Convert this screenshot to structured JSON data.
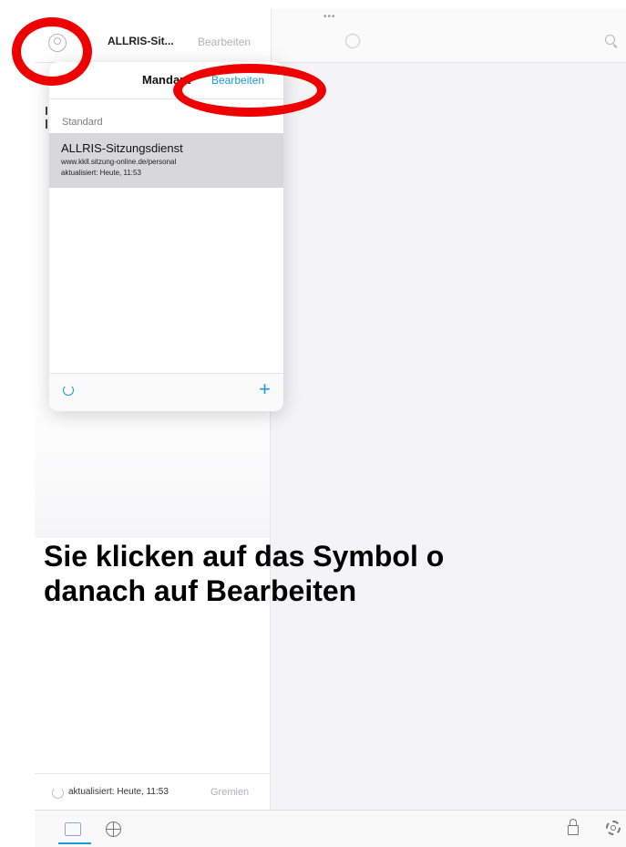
{
  "header": {
    "title": "ALLRIS-Sit...",
    "edit_label": "Bearbeiten",
    "dots": "•••"
  },
  "popover": {
    "title": "Mandant",
    "edit_label": "Bearbeiten",
    "section_label": "Standard",
    "items": [
      {
        "name": "ALLRIS-Sitzungsdienst",
        "url": "www.kkll.sitzung-online.de/personal",
        "updated": "aktualisiert: Heute, 11:53"
      }
    ],
    "add_label": "+"
  },
  "caption": {
    "line1": "Sie klicken auf das Symbol o",
    "line2": "danach auf Bearbeiten"
  },
  "status": {
    "updated": "aktualisiert: Heute, 11:53",
    "gremien": "Gremien"
  },
  "colors": {
    "accent": "#1a9bd7",
    "annotation": "#ef0000"
  },
  "icons": [
    "avatar-icon",
    "phone-icon",
    "search-icon",
    "refresh-icon",
    "plus-icon",
    "calendar-icon",
    "globe-icon",
    "lock-icon",
    "gear-icon"
  ]
}
